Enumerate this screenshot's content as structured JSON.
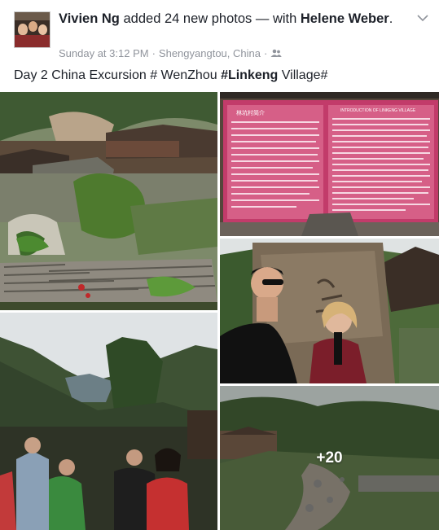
{
  "post": {
    "author": "Vivien Ng",
    "action_pre": "added 24 new photos — with",
    "tagged": "Helene Weber",
    "tagged_suffix": ".",
    "time": "Sunday at 3:12 PM",
    "sep": "·",
    "location": "Shengyangtou, China",
    "audience_icon": "friends-icon",
    "caption_pre": "Day 2 China Excursion # WenZhou",
    "caption_tag": "#Linkeng",
    "caption_post": "Village#"
  },
  "photos": {
    "sign_left_title": "林坑村简介",
    "sign_right_title": "INTRODUCTION OF LINKENG VILLAGE",
    "more_count": "+20"
  },
  "colors": {
    "text": "#1d2129",
    "meta": "#90949c",
    "sign": "#b0345f"
  }
}
